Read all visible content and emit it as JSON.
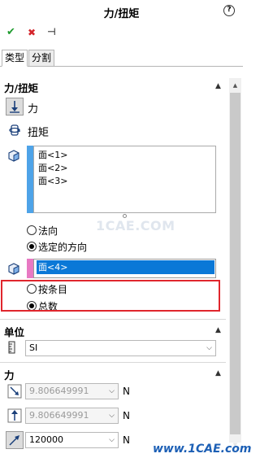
{
  "header": {
    "title": "力/扭矩",
    "help_icon": "?"
  },
  "toolbar": {
    "ok_icon": "✔",
    "cancel_icon": "✖",
    "pin_icon": "⊣"
  },
  "tabs": [
    {
      "label": "类型",
      "active": true
    },
    {
      "label": "分割",
      "active": false
    }
  ],
  "force_torque": {
    "heading": "力/扭矩",
    "options": [
      {
        "label": "力",
        "selected": true
      },
      {
        "label": "扭矩",
        "selected": false
      }
    ],
    "faces": [
      "面<1>",
      "面<2>",
      "面<3>"
    ],
    "direction_options": [
      {
        "label": "法向",
        "selected": false
      },
      {
        "label": "选定的方向",
        "selected": true
      }
    ],
    "direction_reference": "面<4>",
    "distribution_options": [
      {
        "label": "按条目",
        "selected": false
      },
      {
        "label": "总数",
        "selected": true
      }
    ]
  },
  "units": {
    "heading": "单位",
    "system": "SI"
  },
  "force": {
    "heading": "力",
    "components": [
      {
        "value": "9.806649991",
        "unit": "N",
        "enabled": false
      },
      {
        "value": "9.806649991",
        "unit": "N",
        "enabled": false
      },
      {
        "value": "120000",
        "unit": "N",
        "enabled": true
      }
    ]
  },
  "watermarks": {
    "center": "1CAE.COM",
    "bottom": "www.1CAE.com"
  },
  "colors": {
    "selection_bar": "#4ea3e8",
    "highlight_pink": "#e879c3",
    "selected_field": "#0a78d7",
    "annotation_red": "#e0262d"
  }
}
